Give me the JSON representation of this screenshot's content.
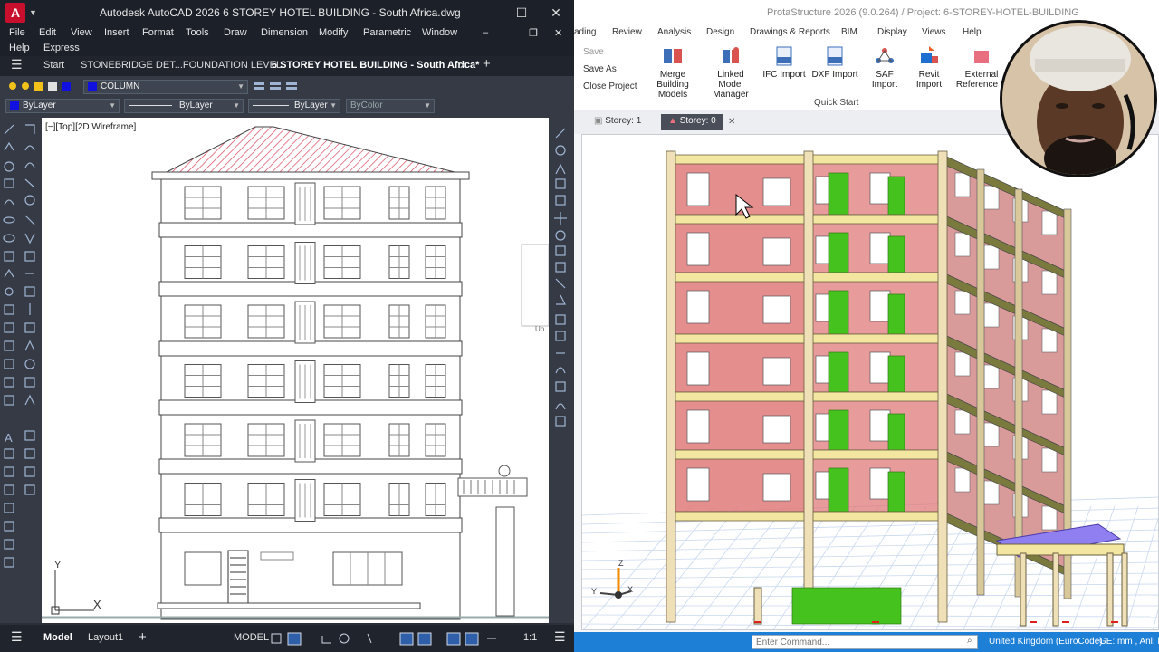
{
  "autocad": {
    "logo": "A",
    "title": "Autodesk AutoCAD 2026    6 STOREY HOTEL BUILDING - South Africa.dwg",
    "window_controls": {
      "minimize": "–",
      "maximize": "☐",
      "close": "✕"
    },
    "menu": [
      "File",
      "Edit",
      "View",
      "Insert",
      "Format",
      "Tools",
      "Draw",
      "Dimension",
      "Modify",
      "Parametric",
      "Window",
      "Help",
      "Express"
    ],
    "doc_controls": {
      "minimize": "–",
      "restore": "❐",
      "close": "✕"
    },
    "tabs": {
      "hamburger": "☰",
      "start": "Start",
      "tab1": "STONEBRIDGE DET...FOUNDATION LEVEL",
      "tab2": "6 STOREY HOTEL BUILDING - South Africa*",
      "close": "✕",
      "add": "+"
    },
    "layer": {
      "name": "COLUMN",
      "color": "#1010e0"
    },
    "properties": {
      "color": "ByLayer",
      "linetype": "ByLayer",
      "lineweight": "ByLayer",
      "plotstyle": "ByColor"
    },
    "viewport_label": "[−][Top][2D Wireframe]",
    "ucs": {
      "x": "X",
      "y": "Y"
    },
    "right_mark": "Up",
    "status": {
      "model_tab": "Model",
      "layout_tab": "Layout1",
      "add": "+",
      "model_mode": "MODEL",
      "scale": "1:1"
    }
  },
  "prota": {
    "title": "ProtaStructure 2026 (9.0.264) / Project: 6-STOREY-HOTEL-BUILDING",
    "ribbon_tabs": [
      "ading",
      "Review",
      "Analysis",
      "Design",
      "Drawings & Reports",
      "BIM",
      "Display",
      "Views",
      "Help"
    ],
    "file_actions": [
      "Save",
      "Save As",
      "Close Project"
    ],
    "buttons": [
      {
        "label": "Merge Building Models",
        "icon": "merge-icon"
      },
      {
        "label": "Linked Model Manager",
        "icon": "linked-model-icon"
      },
      {
        "label": "IFC Import",
        "icon": "ifc-icon"
      },
      {
        "label": "DXF Import",
        "icon": "dxf-icon"
      },
      {
        "label": "SAF Import",
        "icon": "saf-icon"
      },
      {
        "label": "Revit Import",
        "icon": "revit-icon"
      },
      {
        "label": "External Reference D",
        "icon": "external-reference-icon"
      }
    ],
    "group_label": "Quick Start",
    "storey_tabs": [
      "Storey: 1",
      "Storey: 0"
    ],
    "storey_close": "✕",
    "axis": {
      "x": "X",
      "y": "Y",
      "z": "Z"
    },
    "command_placeholder": "Enter Command...",
    "region": "United Kingdom (EuroCode)",
    "units": "GE: mm , Anl: kN"
  },
  "colors": {
    "autocad_bg": "#2b2f38",
    "prota_accent": "#1e7fd6",
    "wall": "#e07a7a",
    "beam": "#f3e6a0",
    "column": "#efe0b8",
    "core": "#46c21e",
    "slab_ext": "#8f7ff0",
    "roof": "#e86f7e"
  }
}
